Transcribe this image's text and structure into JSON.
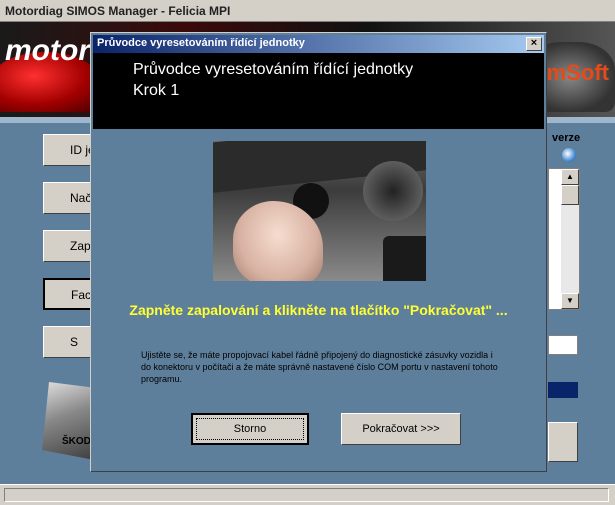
{
  "main_window": {
    "title": "Motordiag  SIMOS Manager - Felicia MPI",
    "logo_text": "motor",
    "brand_text": "mSoft",
    "verze_label": "verze",
    "skoda_label": "ŠKOD",
    "side_buttons": [
      {
        "label": "ID je"
      },
      {
        "label": "Načti"
      },
      {
        "label": "Zapiš"
      },
      {
        "label": "Facto"
      },
      {
        "label": "S"
      }
    ]
  },
  "dialog": {
    "title": "Průvodce vyresetováním řídící jednotky",
    "header_line1": "Průvodce vyresetováním řídící jednotky",
    "header_line2": "Krok 1",
    "main_message": "Zapněte zapalování a  klikněte na tlačítko \"Pokračovat\" ...",
    "info_text": "Ujistěte se, že máte propojovací kabel řádně připojený do diagnostické zásuvky vozidla i do konektoru v počítači a že máte správně nastavené číslo COM portu v nastavení tohoto programu.",
    "buttons": {
      "cancel": "Storno",
      "continue": "Pokračovat >>>"
    },
    "close_glyph": "×"
  },
  "colors": {
    "background": "#5e7f9c",
    "title_bar_start": "#0a246a",
    "title_bar_end": "#a6caf0",
    "message_yellow": "#ffff33"
  },
  "icons": {
    "verze": "globe-icon",
    "close": "close-icon"
  }
}
